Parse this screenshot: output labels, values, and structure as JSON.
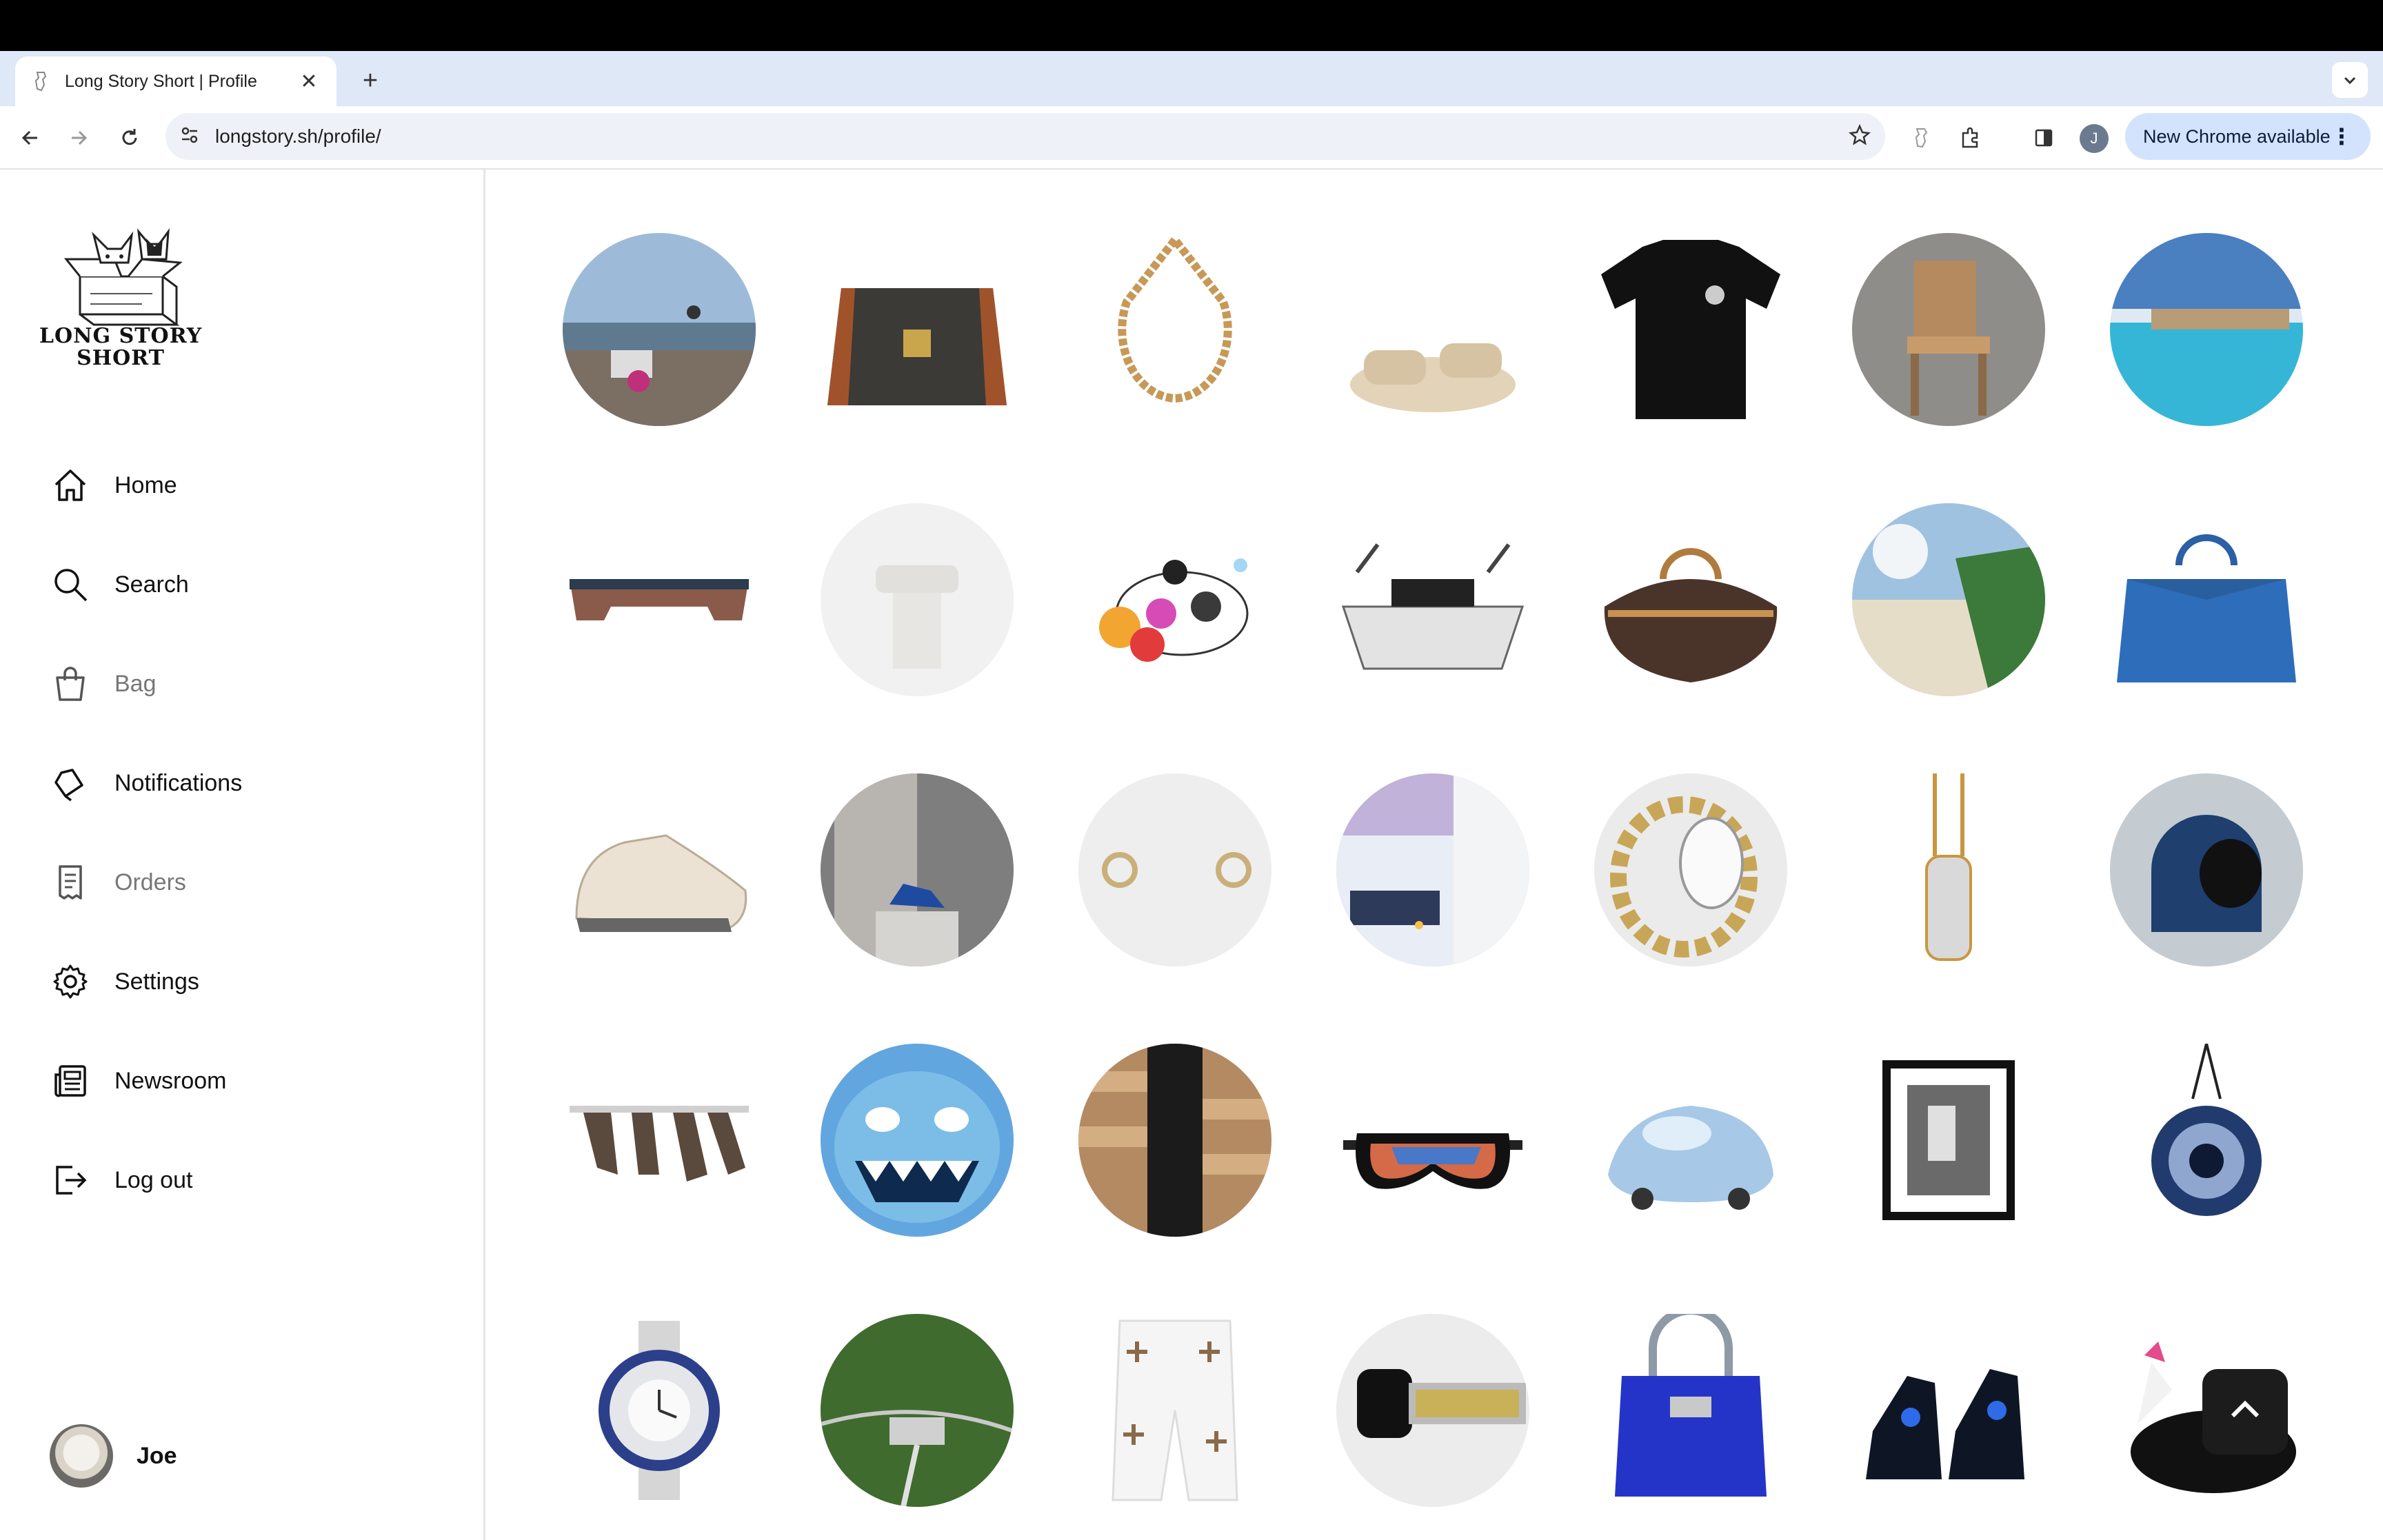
{
  "browser": {
    "tab_title": "Long Story Short | Profile",
    "url": "longstory.sh/profile/",
    "profile_initial": "J",
    "update_label": "New Chrome available"
  },
  "sidebar": {
    "logo_text_line1": "LONG STORY",
    "logo_text_line2": "SHORT",
    "items": [
      {
        "label": "Home",
        "icon": "home-icon"
      },
      {
        "label": "Search",
        "icon": "search-icon"
      },
      {
        "label": "Bag",
        "icon": "bag-icon"
      },
      {
        "label": "Notifications",
        "icon": "bell-icon"
      },
      {
        "label": "Orders",
        "icon": "receipt-icon"
      },
      {
        "label": "Settings",
        "icon": "gear-icon"
      },
      {
        "label": "Newsroom",
        "icon": "newspaper-icon"
      },
      {
        "label": "Log out",
        "icon": "logout-icon"
      }
    ],
    "user_name": "Joe"
  },
  "grid_items": [
    "dog-on-beach",
    "trunk-case",
    "gold-necklace",
    "fuzzy-slides",
    "black-tshirt",
    "wooden-chair",
    "cliffside-pool",
    "wooden-table",
    "white-stool",
    "panda-sculpture",
    "boat-model",
    "monogram-duffel",
    "beach-resort",
    "blue-handbag",
    "white-sneakers",
    "gallery-sculpture",
    "stud-earrings",
    "snow-villa",
    "serpent-watch",
    "diamond-pendant",
    "space-helmet",
    "glass-table",
    "blue-monster-art",
    "wood-panels",
    "ski-goggles",
    "blue-microcar",
    "framed-photo",
    "eye-pendant",
    "steel-watch",
    "aerial-estate",
    "cross-jeans",
    "smartwatch",
    "blue-kelly-bag",
    "high-top-sneakers",
    "unicorn-float"
  ]
}
